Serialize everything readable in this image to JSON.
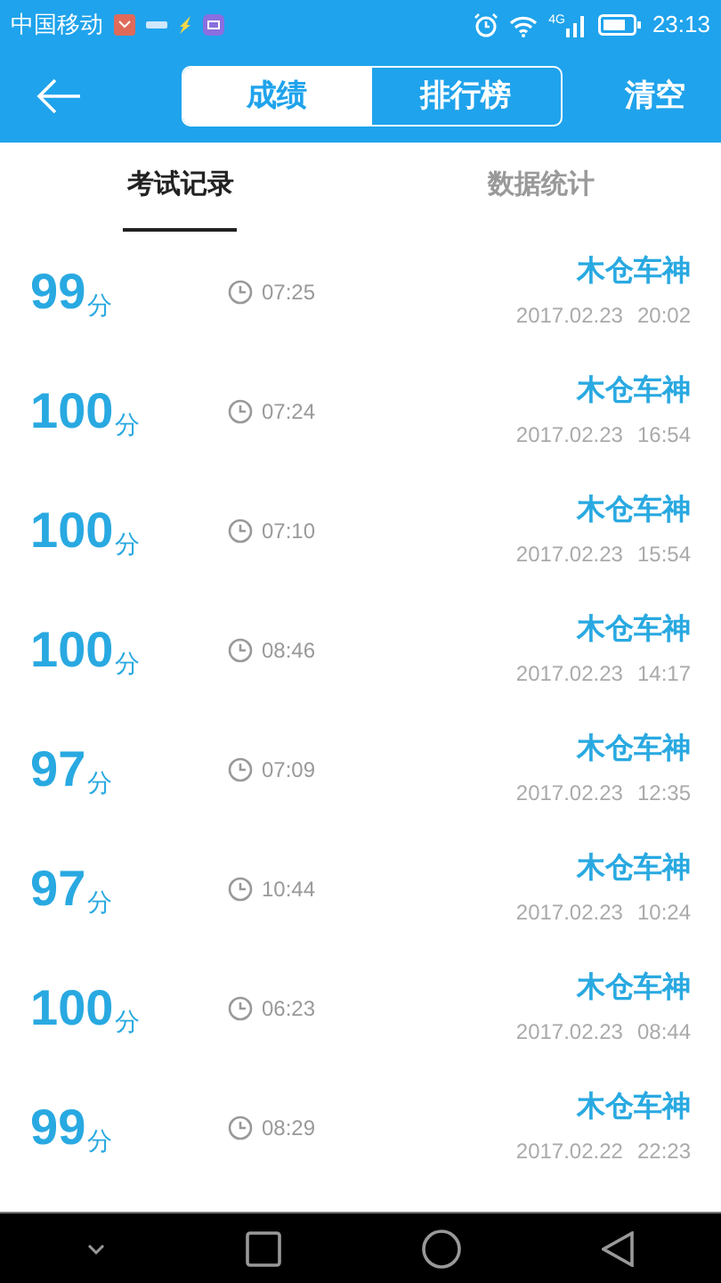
{
  "status_bar": {
    "carrier": "中国移动",
    "network": "4G",
    "time": "23:13"
  },
  "header": {
    "segments": [
      {
        "label": "成绩",
        "selected": true
      },
      {
        "label": "排行榜",
        "selected": false
      }
    ],
    "action": "清空"
  },
  "tabs": [
    {
      "label": "考试记录",
      "selected": true
    },
    {
      "label": "数据统计",
      "selected": false
    }
  ],
  "records": [
    {
      "score": "99",
      "unit": "分",
      "duration": "07:25",
      "name": "木仓车神",
      "date": "2017.02.23",
      "time": "20:02"
    },
    {
      "score": "100",
      "unit": "分",
      "duration": "07:24",
      "name": "木仓车神",
      "date": "2017.02.23",
      "time": "16:54"
    },
    {
      "score": "100",
      "unit": "分",
      "duration": "07:10",
      "name": "木仓车神",
      "date": "2017.02.23",
      "time": "15:54"
    },
    {
      "score": "100",
      "unit": "分",
      "duration": "08:46",
      "name": "木仓车神",
      "date": "2017.02.23",
      "time": "14:17"
    },
    {
      "score": "97",
      "unit": "分",
      "duration": "07:09",
      "name": "木仓车神",
      "date": "2017.02.23",
      "time": "12:35"
    },
    {
      "score": "97",
      "unit": "分",
      "duration": "10:44",
      "name": "木仓车神",
      "date": "2017.02.23",
      "time": "10:24"
    },
    {
      "score": "100",
      "unit": "分",
      "duration": "06:23",
      "name": "木仓车神",
      "date": "2017.02.23",
      "time": "08:44"
    },
    {
      "score": "99",
      "unit": "分",
      "duration": "08:29",
      "name": "木仓车神",
      "date": "2017.02.22",
      "time": "22:23"
    }
  ]
}
